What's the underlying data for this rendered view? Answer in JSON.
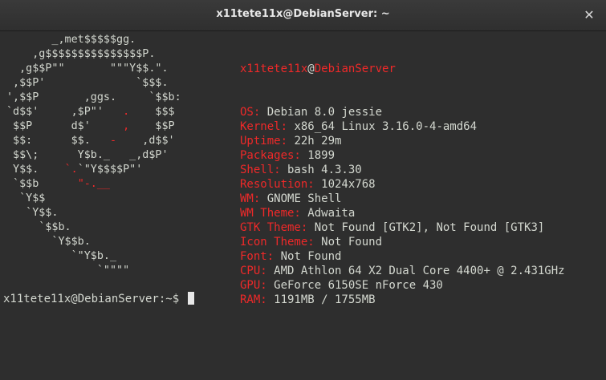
{
  "window": {
    "title": "x11tete11x@DebianServer: ~",
    "close_glyph": "✕"
  },
  "logo": [
    "       _,met$$$$$gg.",
    "    ,g$$$$$$$$$$$$$$$P.",
    "  ,g$$P\"\"       \"\"\"Y$$.\".",
    " ,$$P'              `$$$.",
    "',$$P       ,ggs.     `$$b:",
    "`d$$'     ,$P\"'   .    $$$",
    " $$P      d$'     ,    $$P",
    " $$:      $$.   -    ,d$$'",
    " $$\\;      Y$b._   _,d$P'",
    " Y$$.    `.`\"Y$$$$P\"'",
    " `$$b      \"-.__",
    "  `Y$$",
    "   `Y$$.",
    "     `$$b.",
    "       `Y$$b.",
    "          `\"Y$b._",
    "              `\"\"\"\""
  ],
  "info": {
    "user": "x11tete11x",
    "at": "@",
    "host": "DebianServer",
    "fields": [
      {
        "label": "OS:",
        "value": " Debian 8.0 jessie"
      },
      {
        "label": "Kernel:",
        "value": " x86_64 Linux 3.16.0-4-amd64"
      },
      {
        "label": "Uptime:",
        "value": " 22h 29m"
      },
      {
        "label": "Packages:",
        "value": " 1899"
      },
      {
        "label": "Shell:",
        "value": " bash 4.3.30"
      },
      {
        "label": "Resolution:",
        "value": " 1024x768"
      },
      {
        "label": "WM:",
        "value": " GNOME Shell"
      },
      {
        "label": "WM Theme:",
        "value": " Adwaita"
      },
      {
        "label": "GTK Theme:",
        "value": " Not Found [GTK2], Not Found [GTK3]"
      },
      {
        "label": "Icon Theme:",
        "value": " Not Found"
      },
      {
        "label": "Font:",
        "value": " Not Found"
      },
      {
        "label": "CPU:",
        "value": " AMD Athlon 64 X2 Dual Core 4400+ @ 2.431GHz"
      },
      {
        "label": "GPU:",
        "value": " GeForce 6150SE nForce 430"
      },
      {
        "label": "RAM:",
        "value": " 1191MB / 1755MB"
      }
    ]
  },
  "prompt": {
    "text": "x11tete11x@DebianServer:~$ "
  },
  "colors": {
    "accent_red": "#ef2929",
    "text": "#d3d7cf",
    "background": "#2e2e2e"
  }
}
